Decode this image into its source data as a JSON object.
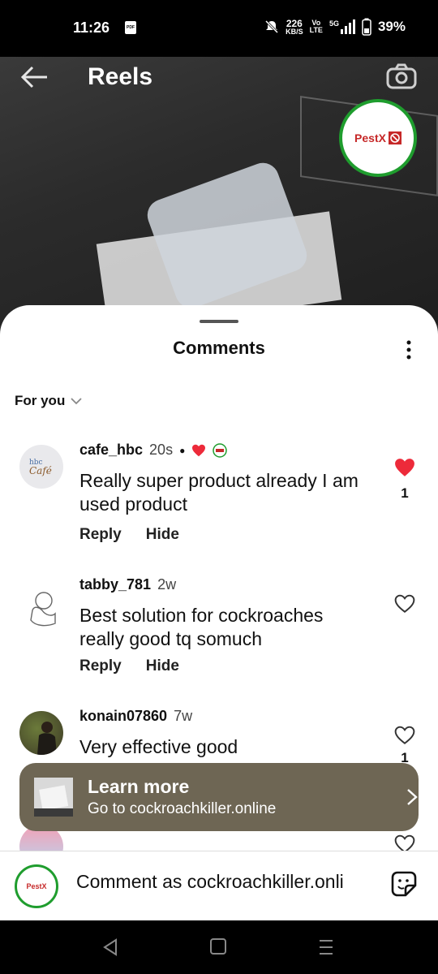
{
  "status_bar": {
    "time": "11:26",
    "pdf_badge": "PDF",
    "net_speed_value": "226",
    "net_speed_unit": "KB/S",
    "volte": "Vo",
    "lte": "LTE",
    "network": "5G",
    "battery": "39%"
  },
  "header": {
    "title": "Reels",
    "brand_badge": "PestX"
  },
  "comments_sheet": {
    "title": "Comments",
    "filter_label": "For you"
  },
  "comments": [
    {
      "username": "cafe_hbc",
      "time": "20s",
      "text": "Really super product  already I am used product",
      "reply_label": "Reply",
      "hide_label": "Hide",
      "liked": true,
      "like_count": "1"
    },
    {
      "username": "tabby_781",
      "time": "2w",
      "text": "Best solution for cockroaches really good tq somuch",
      "reply_label": "Reply",
      "hide_label": "Hide",
      "liked": false
    },
    {
      "username": "konain07860",
      "time": "7w",
      "text": "Very effective good",
      "liked": false,
      "like_count": "1"
    }
  ],
  "banner": {
    "title": "Learn more",
    "subtitle": "Go to cockroachkiller.online"
  },
  "input": {
    "placeholder": "Comment as cockroachkiller.onli"
  },
  "colors": {
    "like_red": "#ed2a3a",
    "brand_green": "#1f9d2e",
    "banner_bg": "#6e6654"
  }
}
